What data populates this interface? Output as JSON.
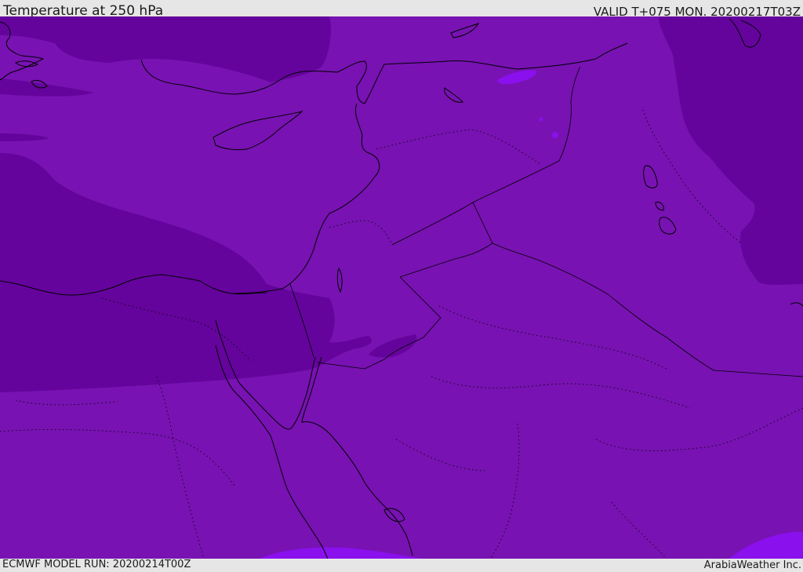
{
  "header": {
    "title": "Temperature at 250 hPa",
    "valid": "VALID T+075 MON. 20200217T03Z"
  },
  "footer": {
    "model_run": "ECMWF MODEL RUN: 20200214T00Z",
    "credit": "ArabiaWeather Inc."
  },
  "map": {
    "colors": {
      "main_fill": "#7812b2",
      "cold_band": "#64049c",
      "warm_patch": "#7e0ed6",
      "warmer_patch": "#8a10ee",
      "coastline": "#000000"
    }
  }
}
